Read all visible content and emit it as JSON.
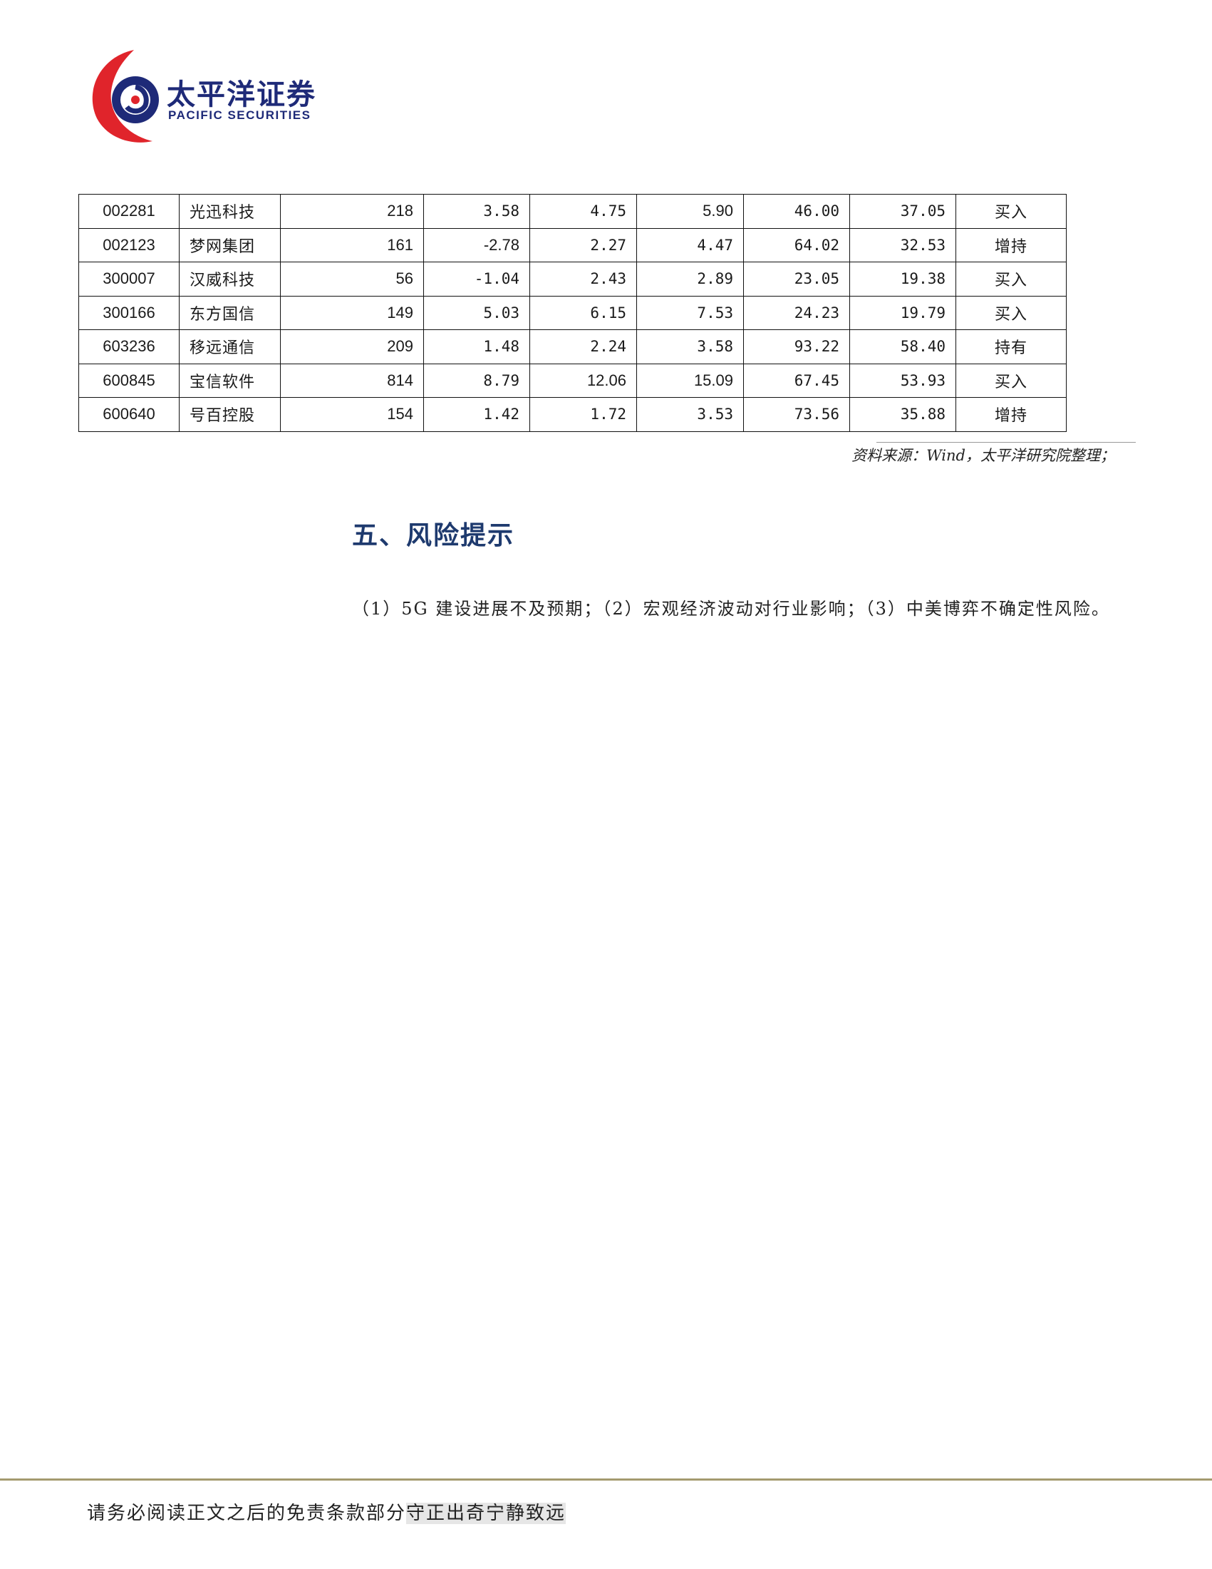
{
  "logo": {
    "name_cn": "太平洋证券",
    "name_en": "PACIFIC SECURITIES"
  },
  "table": {
    "rows": [
      {
        "code": "002281",
        "name": "光迅科技",
        "c1": "218",
        "c2": "3.58",
        "c3": "4.75",
        "c4": "5.90",
        "c5": "46.00",
        "c6": "37.05",
        "rating": "买入"
      },
      {
        "code": "002123",
        "name": "梦网集团",
        "c1": "161",
        "c2": "-2.78",
        "c3": "2.27",
        "c4": "4.47",
        "c5": "64.02",
        "c6": "32.53",
        "rating": "增持"
      },
      {
        "code": "300007",
        "name": "汉威科技",
        "c1": "56",
        "c2": "-1.04",
        "c3": "2.43",
        "c4": "2.89",
        "c5": "23.05",
        "c6": "19.38",
        "rating": "买入"
      },
      {
        "code": "300166",
        "name": "东方国信",
        "c1": "149",
        "c2": "5.03",
        "c3": "6.15",
        "c4": "7.53",
        "c5": "24.23",
        "c6": "19.79",
        "rating": "买入"
      },
      {
        "code": "603236",
        "name": "移远通信",
        "c1": "209",
        "c2": "1.48",
        "c3": "2.24",
        "c4": "3.58",
        "c5": "93.22",
        "c6": "58.40",
        "rating": "持有"
      },
      {
        "code": "600845",
        "name": "宝信软件",
        "c1": "814",
        "c2": "8.79",
        "c3": "12.06",
        "c4": "15.09",
        "c5": "67.45",
        "c6": "53.93",
        "rating": "买入"
      },
      {
        "code": "600640",
        "name": "号百控股",
        "c1": "154",
        "c2": "1.42",
        "c3": "1.72",
        "c4": "3.53",
        "c5": "73.56",
        "c6": "35.88",
        "rating": "增持"
      }
    ],
    "source": "资料来源：Wind，太平洋研究院整理；"
  },
  "section": {
    "title": "五、风险提示",
    "body": "（1）5G 建设进展不及预期；（2）宏观经济波动对行业影响；（3）中美博弈不确定性风险。"
  },
  "footer": {
    "disclaimer": "请务必阅读正文之后的免责条款部分",
    "slogan": "守正出奇宁静致远"
  },
  "colors": {
    "brand_red": "#e0242b",
    "brand_blue": "#1e2a78",
    "footer_rule": "#a49a6e"
  }
}
